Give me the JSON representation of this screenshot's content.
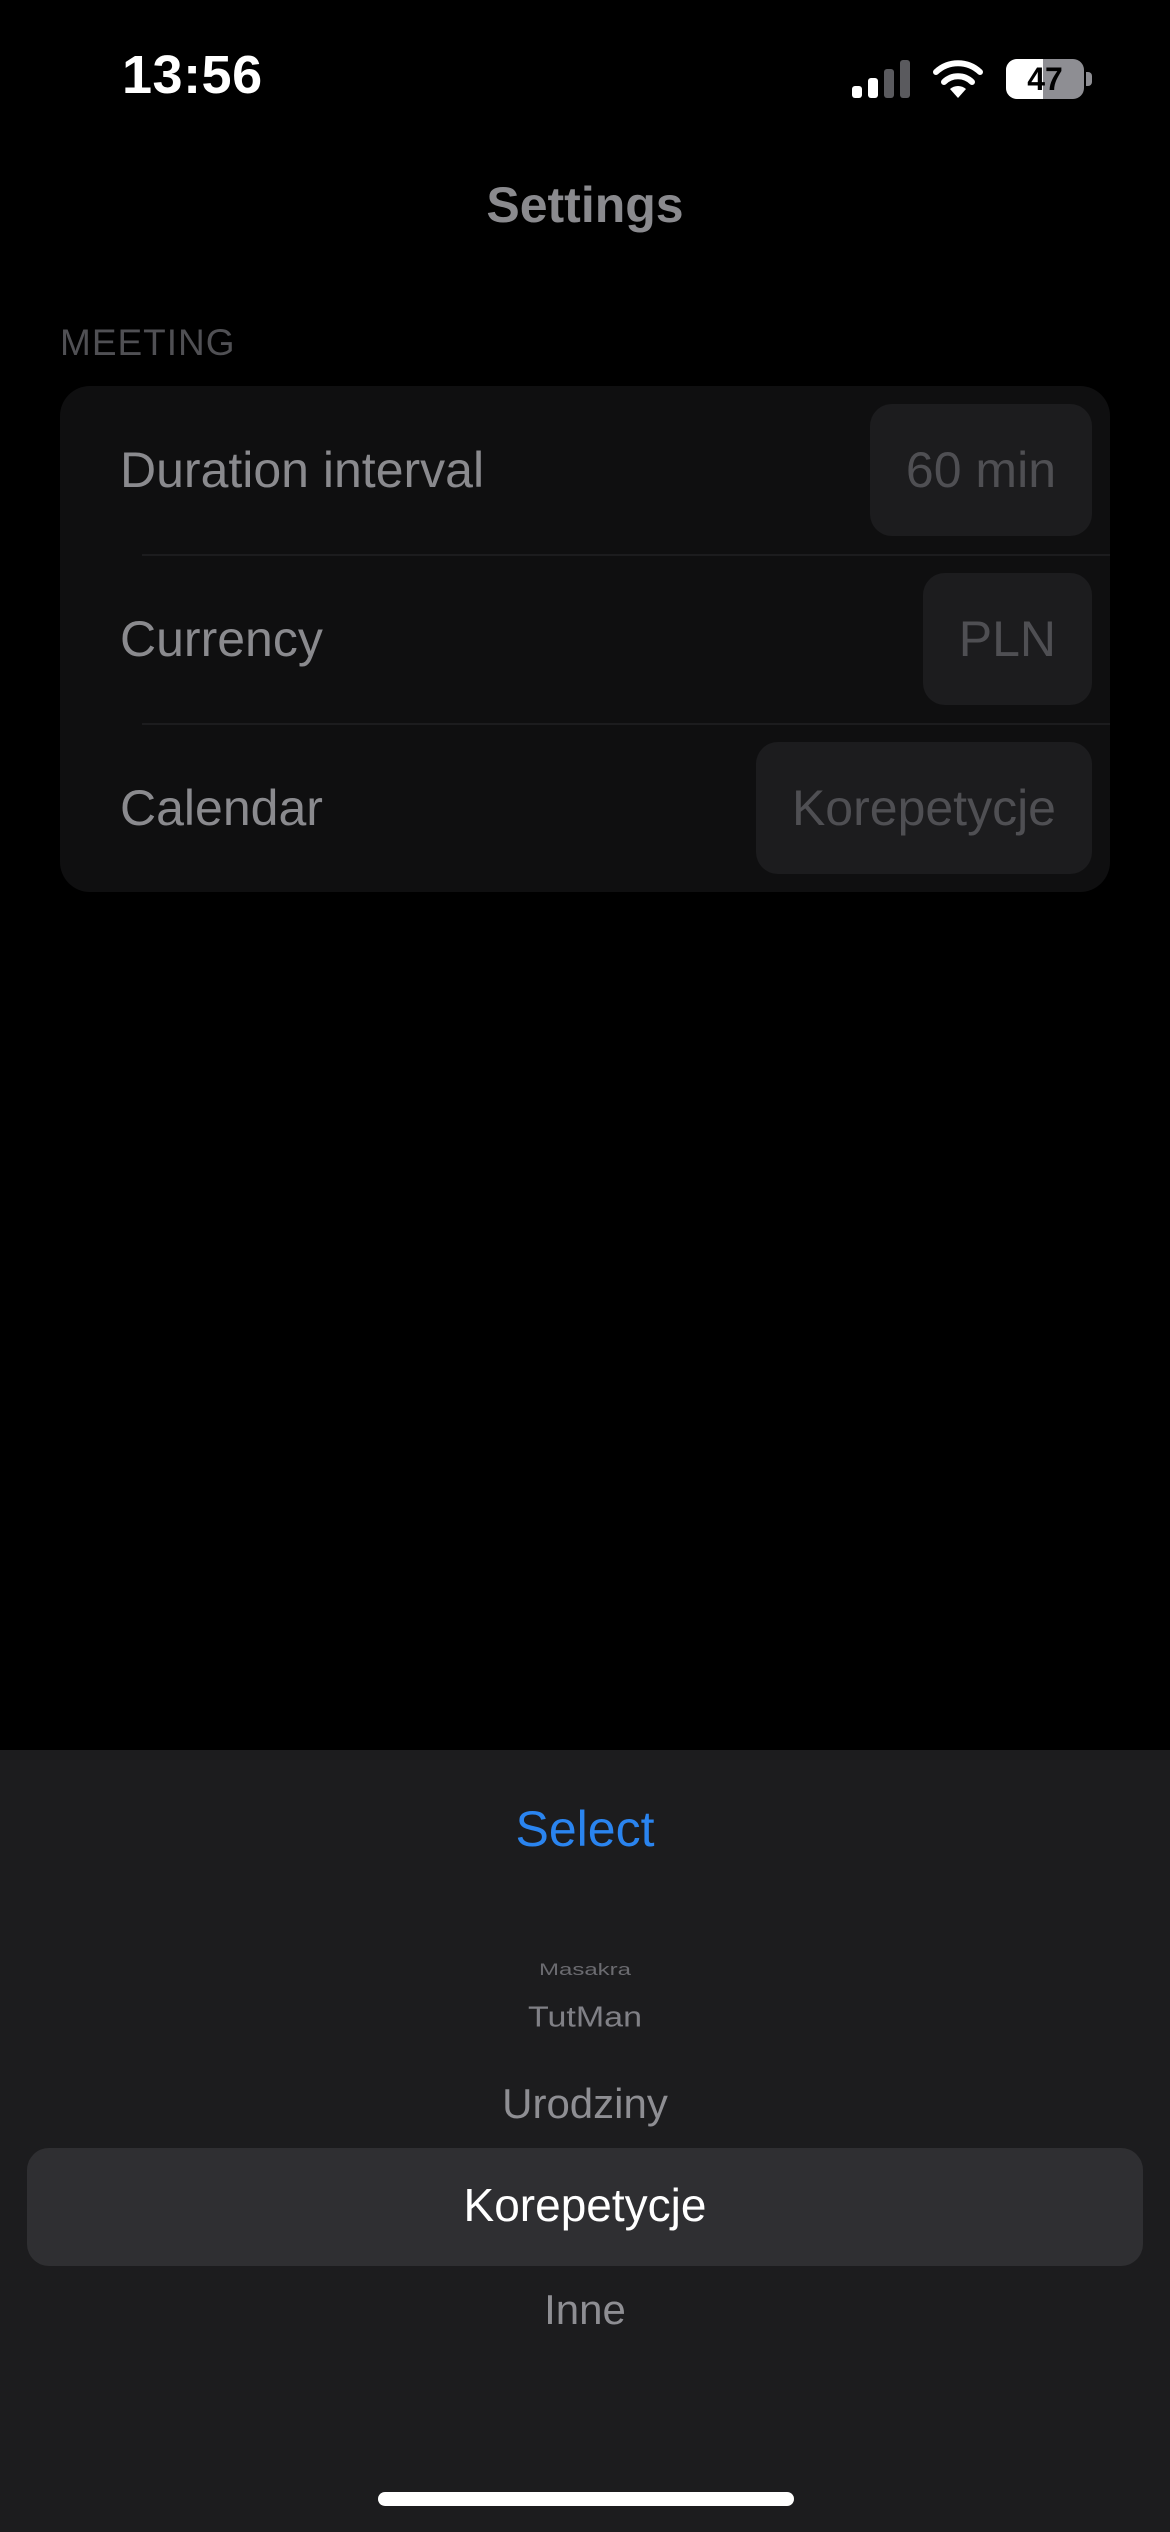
{
  "status_bar": {
    "time": "13:56",
    "battery": "47",
    "battery_level": 0.47,
    "icons": [
      "signal-icon",
      "wifi-icon",
      "battery-icon"
    ]
  },
  "nav": {
    "title": "Settings"
  },
  "meeting": {
    "header": "MEETING",
    "rows": [
      {
        "label": "Duration interval",
        "value": "60 min"
      },
      {
        "label": "Currency",
        "value": "PLN"
      },
      {
        "label": "Calendar",
        "value": "Korepetycje"
      }
    ]
  },
  "picker": {
    "select_label": "Select",
    "items": [
      "Masakra",
      "TutMan",
      "Urodziny",
      "Korepetycje",
      "Inne"
    ],
    "selected": "Korepetycje"
  },
  "colors": {
    "accent": "#2a84ef",
    "sheet_bg": "#1c1c1e",
    "highlight": "#2f2f32"
  }
}
